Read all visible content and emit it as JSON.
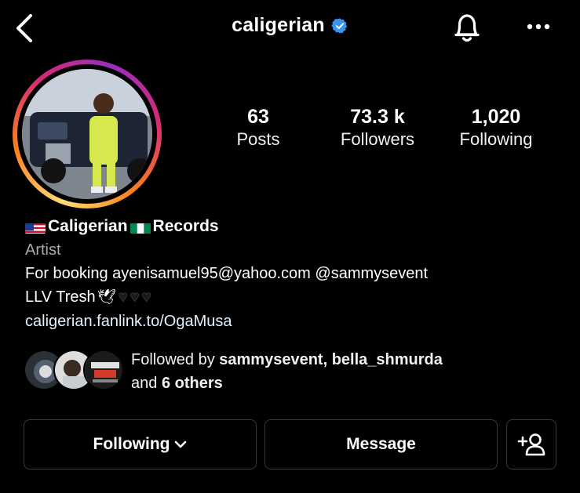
{
  "header": {
    "username": "caligerian",
    "verified": true,
    "icons": [
      "back-arrow-icon",
      "verified-badge-icon",
      "bell-icon",
      "more-dots-icon"
    ]
  },
  "stats": [
    {
      "value": "63",
      "label": "Posts"
    },
    {
      "value": "73.3 k",
      "label": "Followers"
    },
    {
      "value": "1,020",
      "label": "Following"
    }
  ],
  "bio": {
    "name_part1": "Caligerian",
    "name_part2": "Records",
    "category": "Artist",
    "line1": "For booking ayenisamuel95@yahoo.com @sammysevent",
    "line2": "LLV Tresh",
    "link": "caligerian.fanlink.to/OgaMusa"
  },
  "followed_by": {
    "prefix": "Followed by ",
    "names": "sammysevent, bella_shmurda",
    "and": "and ",
    "others": "6 others"
  },
  "actions": {
    "following_label": "Following",
    "message_label": "Message"
  },
  "colors": {
    "background": "#000000",
    "verified": "#3797f0",
    "button_border": "#3a3a3a",
    "category_text": "#a8a8a8",
    "link_text": "#e0f1ff"
  }
}
